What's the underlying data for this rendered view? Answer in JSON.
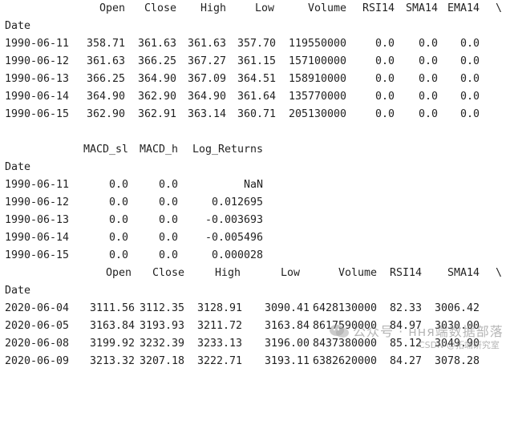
{
  "tables": [
    {
      "columns": [
        "Open",
        "Close",
        "High",
        "Low",
        "Volume",
        "RSI14",
        "SMA14",
        "EMA14"
      ],
      "continuation": "\\",
      "index_name": "Date",
      "rows": [
        {
          "date": "1990-06-11",
          "values": [
            "358.71",
            "361.63",
            "361.63",
            "357.70",
            "119550000",
            "0.0",
            "0.0",
            "0.0"
          ]
        },
        {
          "date": "1990-06-12",
          "values": [
            "361.63",
            "366.25",
            "367.27",
            "361.15",
            "157100000",
            "0.0",
            "0.0",
            "0.0"
          ]
        },
        {
          "date": "1990-06-13",
          "values": [
            "366.25",
            "364.90",
            "367.09",
            "364.51",
            "158910000",
            "0.0",
            "0.0",
            "0.0"
          ]
        },
        {
          "date": "1990-06-14",
          "values": [
            "364.90",
            "362.90",
            "364.90",
            "361.64",
            "135770000",
            "0.0",
            "0.0",
            "0.0"
          ]
        },
        {
          "date": "1990-06-15",
          "values": [
            "362.90",
            "362.91",
            "363.14",
            "360.71",
            "205130000",
            "0.0",
            "0.0",
            "0.0"
          ]
        }
      ]
    },
    {
      "columns": [
        "MACD_sl",
        "MACD_h",
        "Log_Returns"
      ],
      "index_name": "Date",
      "rows": [
        {
          "date": "1990-06-11",
          "values": [
            "0.0",
            "0.0",
            "NaN"
          ]
        },
        {
          "date": "1990-06-12",
          "values": [
            "0.0",
            "0.0",
            "0.012695"
          ]
        },
        {
          "date": "1990-06-13",
          "values": [
            "0.0",
            "0.0",
            "-0.003693"
          ]
        },
        {
          "date": "1990-06-14",
          "values": [
            "0.0",
            "0.0",
            "-0.005496"
          ]
        },
        {
          "date": "1990-06-15",
          "values": [
            "0.0",
            "0.0",
            "0.000028"
          ]
        }
      ]
    },
    {
      "columns": [
        "Open",
        "Close",
        "High",
        "Low",
        "Volume",
        "RSI14",
        "SMA14"
      ],
      "continuation": "\\",
      "index_name": "Date",
      "rows": [
        {
          "date": "2020-06-04",
          "values": [
            "3111.56",
            "3112.35",
            "3128.91",
            "3090.41",
            "6428130000",
            "82.33",
            "3006.42"
          ]
        },
        {
          "date": "2020-06-05",
          "values": [
            "3163.84",
            "3193.93",
            "3211.72",
            "3163.84",
            "8617590000",
            "84.97",
            "3030.00"
          ]
        },
        {
          "date": "2020-06-08",
          "values": [
            "3199.92",
            "3232.39",
            "3233.13",
            "3196.00",
            "8437380000",
            "85.12",
            "3049.90"
          ]
        },
        {
          "date": "2020-06-09",
          "values": [
            "3213.32",
            "3207.18",
            "3222.71",
            "3193.11",
            "6382620000",
            "84.27",
            "3078.28"
          ]
        }
      ]
    }
  ],
  "watermark": {
    "icon": "wechat-icon",
    "text": "公众号 · ння端数据部落",
    "sub": "CSDN @拓端研究室"
  }
}
